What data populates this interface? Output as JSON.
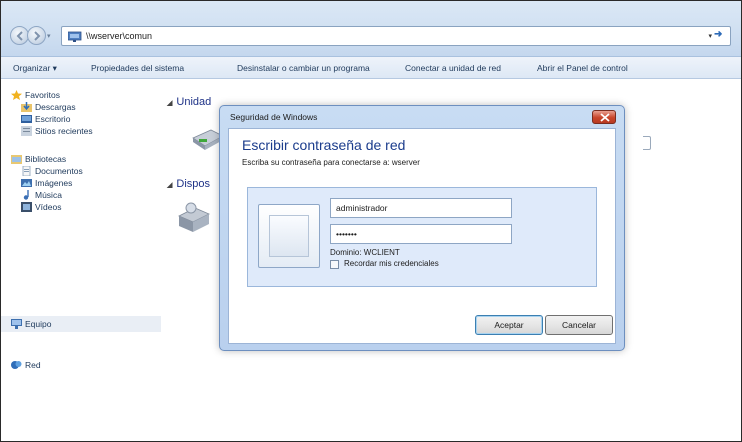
{
  "explorer": {
    "address": "\\\\wserver\\comun",
    "commands": [
      "Organizar ▾",
      "Propiedades del sistema",
      "Desinstalar o cambiar un programa",
      "Conectar a unidad de red",
      "Abrir el Panel de control"
    ],
    "nav": {
      "favorites": "Favoritos",
      "downloads": "Descargas",
      "desktop": "Escritorio",
      "recent": "Sitios recientes",
      "libraries": "Bibliotecas",
      "documents": "Documentos",
      "pictures": "Imágenes",
      "music": "Música",
      "videos": "Vídeos",
      "computer": "Equipo",
      "network": "Red"
    },
    "groups": {
      "drives": "Unidad",
      "devices": "Dispos"
    }
  },
  "dialog": {
    "title": "Seguridad de Windows",
    "heading": "Escribir contraseña de red",
    "subtitle": "Escriba su contraseña para conectarse a: wserver",
    "username": "administrador",
    "password": "•••••••",
    "domain": "Dominio: WCLIENT",
    "remember": "Recordar mis credenciales",
    "ok": "Aceptar",
    "cancel": "Cancelar"
  },
  "colors": {
    "heading": "#1b3c8c",
    "close_button": "#c9462b",
    "nav_text": "#1e395b"
  }
}
